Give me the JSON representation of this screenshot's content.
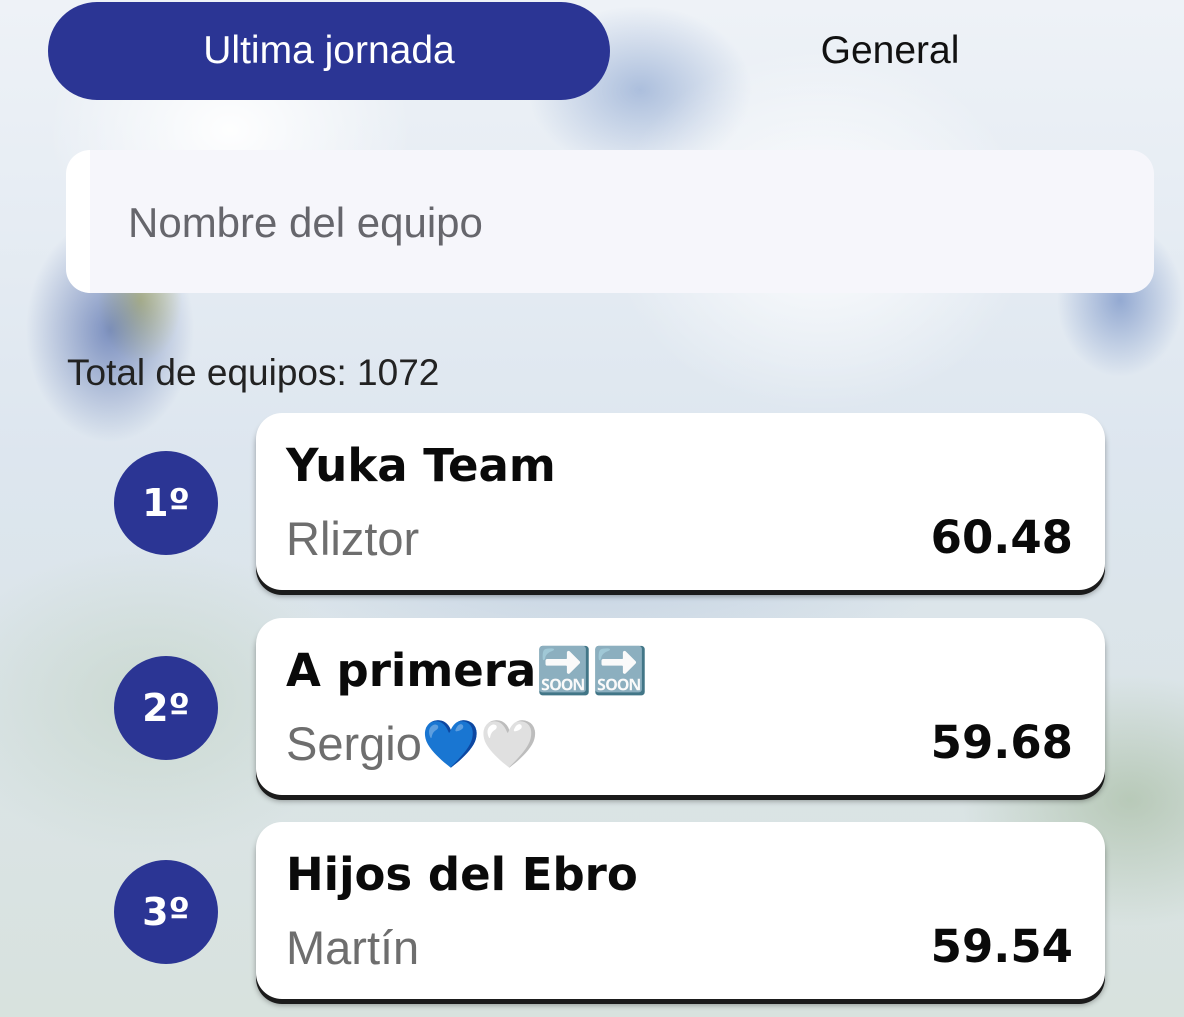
{
  "tabs": {
    "active_label": "Ultima jornada",
    "inactive_label": "General"
  },
  "search": {
    "placeholder": "Nombre del equipo",
    "value": ""
  },
  "summary": {
    "total_label": "Total de equipos: 1072"
  },
  "ranking": [
    {
      "position": "1º",
      "team": "Yuka Team",
      "owner": "Rliztor",
      "points": "60.48"
    },
    {
      "position": "2º",
      "team": "A primera🔜🔜",
      "owner": "Sergio💙🤍",
      "points": "59.68"
    },
    {
      "position": "3º",
      "team": "Hijos del Ebro",
      "owner": "Martín",
      "points": "59.54"
    }
  ],
  "colors": {
    "accent": "#2b3594",
    "card": "#ffffff",
    "search_bg": "#f6f6fb"
  }
}
